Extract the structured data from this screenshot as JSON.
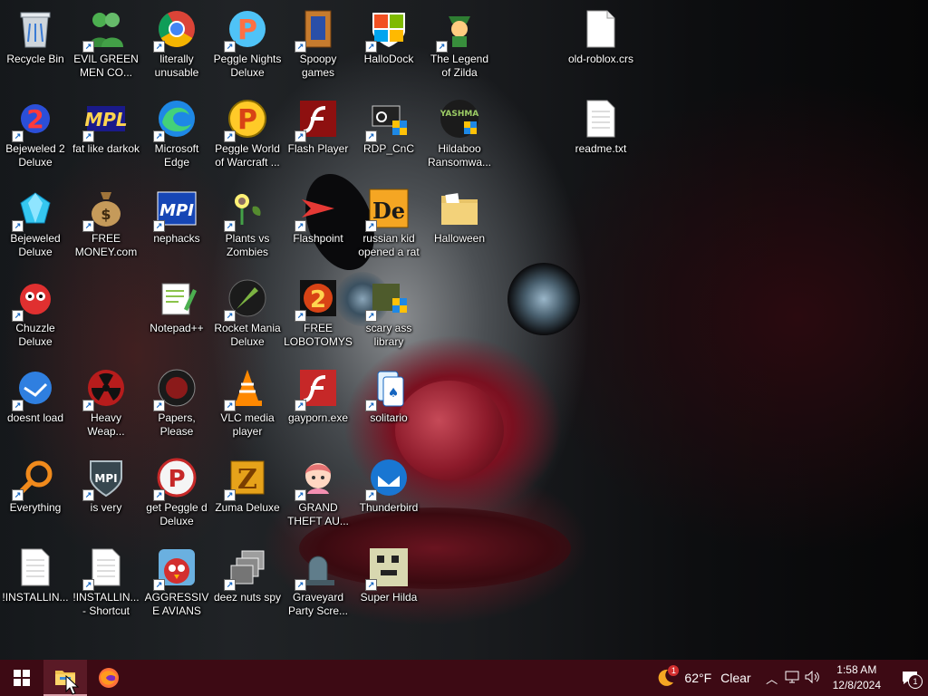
{
  "desktop": {
    "icons": [
      {
        "label": "Recycle Bin"
      },
      {
        "label": "EVIL GREEN MEN CO..."
      },
      {
        "label": "literally unusable"
      },
      {
        "label": "Peggle Nights Deluxe"
      },
      {
        "label": "Spoopy games"
      },
      {
        "label": "HalloDock"
      },
      {
        "label": "The Legend of Zilda"
      },
      {
        "label": "old-roblox.crs"
      },
      {
        "label": "Bejeweled 2 Deluxe"
      },
      {
        "label": "fat like darkok"
      },
      {
        "label": "Microsoft Edge"
      },
      {
        "label": "Peggle World of Warcraft ..."
      },
      {
        "label": "Flash Player"
      },
      {
        "label": "RDP_CnC"
      },
      {
        "label": "Hildaboo Ransomwa..."
      },
      {
        "label": "readme.txt"
      },
      {
        "label": "Bejeweled Deluxe"
      },
      {
        "label": "FREE MONEY.com"
      },
      {
        "label": "nephacks"
      },
      {
        "label": "Plants vs Zombies"
      },
      {
        "label": "Flashpoint"
      },
      {
        "label": "russian kid opened a rat"
      },
      {
        "label": "Halloween"
      },
      {
        "label": "Chuzzle Deluxe"
      },
      {
        "label": "Notepad++"
      },
      {
        "label": "Rocket Mania Deluxe"
      },
      {
        "label": "FREE LOBOTOMYS"
      },
      {
        "label": "scary ass library"
      },
      {
        "label": "doesnt load"
      },
      {
        "label": "Heavy Weap..."
      },
      {
        "label": "Papers, Please"
      },
      {
        "label": "VLC media player"
      },
      {
        "label": "gayporn.exe"
      },
      {
        "label": "solitario"
      },
      {
        "label": "Everything"
      },
      {
        "label": "is very"
      },
      {
        "label": "get Peggle d Deluxe"
      },
      {
        "label": "Zuma Deluxe"
      },
      {
        "label": "GRAND THEFT AU..."
      },
      {
        "label": "Thunderbird"
      },
      {
        "label": "!INSTALLIN..."
      },
      {
        "label": "!INSTALLIN... - Shortcut"
      },
      {
        "label": "AGGRESSIVE AVIANS"
      },
      {
        "label": "deez nuts spy"
      },
      {
        "label": "Graveyard Party Scre..."
      },
      {
        "label": "Super Hilda"
      }
    ],
    "yashma_text": "YASHMA",
    "mpi_text": "MPI",
    "de_text": "De"
  },
  "taskbar": {
    "weather_temp": "62°F",
    "weather_cond": "Clear",
    "time": "1:58 AM",
    "date": "12/8/2024",
    "notif_count": "1",
    "weather_badge": "1"
  },
  "colors": {
    "taskbar_bg": "#3d0a14",
    "accent": "#0078d7"
  }
}
